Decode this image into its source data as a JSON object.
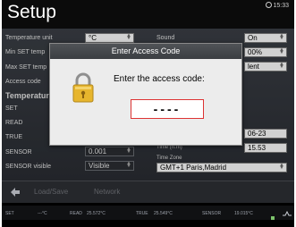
{
  "header": {
    "title": "Setup",
    "clock": "15:33"
  },
  "left_settings": [
    {
      "label": "Temperature unit",
      "value": "°C"
    },
    {
      "label": "Min SET temp",
      "value": ""
    },
    {
      "label": "Max SET temp",
      "value": ""
    },
    {
      "label": "Access code",
      "value": ""
    }
  ],
  "left_section": {
    "heading": "Temperature",
    "rows": [
      "SET",
      "READ",
      "TRUE"
    ],
    "sensor_label": "SENSOR",
    "sensor_value": "0.001",
    "sensor_visible_label": "SENSOR visible",
    "sensor_visible_value": "Visible"
  },
  "right_settings": {
    "sound_label": "Sound",
    "sound_value": "On",
    "row2_value": "00%",
    "row3_value": "lent",
    "date_value": "06-23",
    "time_label": "Time (h.m)",
    "time_value": "15.53",
    "timezone_label": "Time Zone",
    "timezone_value": "GMT+1 Paris,Madrid"
  },
  "toolbar": {
    "back_icon": "back-arrow-icon",
    "load_save_label": "Load/Save",
    "network_label": "Network"
  },
  "status_bar": {
    "set_label": "SET",
    "set_value": "---°C",
    "read_label": "READ",
    "read_value": "25.572°C",
    "true_label": "TRUE",
    "true_value": "25.549°C",
    "sensor_label": "SENSOR",
    "sensor_value": "19.015°C"
  },
  "dialog": {
    "title": "Enter Access Code",
    "prompt": "Enter the access code:",
    "code_value": "----",
    "icon": "padlock-icon"
  }
}
